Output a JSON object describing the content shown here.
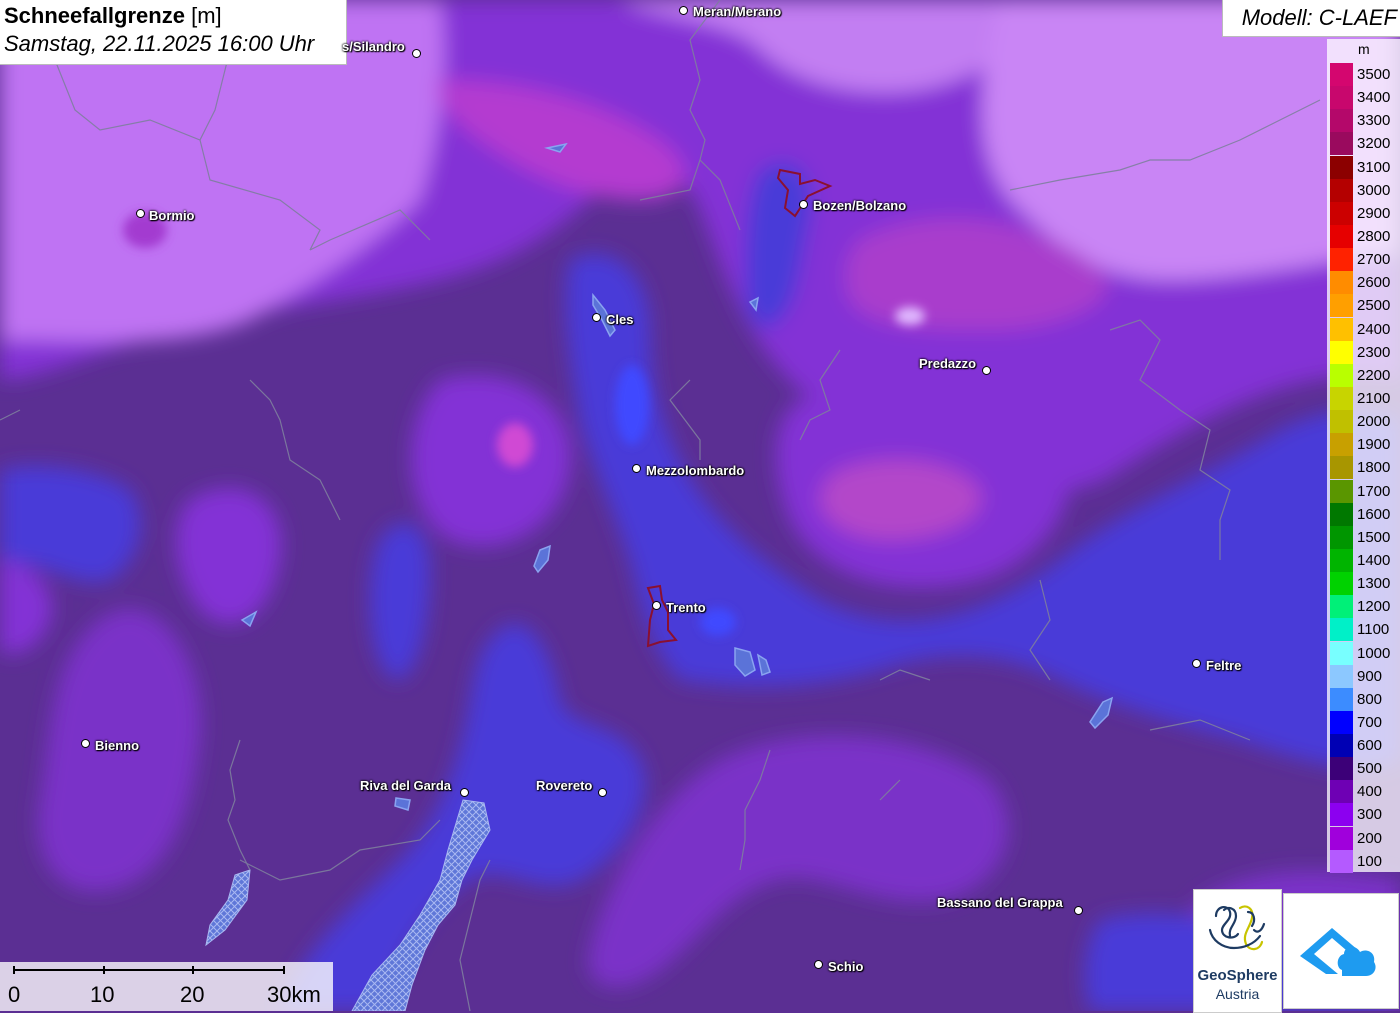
{
  "title": {
    "main": "Schneefallgrenze",
    "unit": "[m]",
    "datetime": "Samstag, 22.11.2025 16:00 Uhr"
  },
  "model": "Modell: C-LAEF",
  "legend": {
    "unit": "m",
    "entries": [
      {
        "label": "3500",
        "color": "#d4066f"
      },
      {
        "label": "3400",
        "color": "#c8076d"
      },
      {
        "label": "3300",
        "color": "#b4086a"
      },
      {
        "label": "3200",
        "color": "#9a0a5e"
      },
      {
        "label": "3100",
        "color": "#8c0000"
      },
      {
        "label": "3000",
        "color": "#b40000"
      },
      {
        "label": "2900",
        "color": "#cc0000"
      },
      {
        "label": "2800",
        "color": "#e60000"
      },
      {
        "label": "2700",
        "color": "#ff2200"
      },
      {
        "label": "2600",
        "color": "#ff8c00"
      },
      {
        "label": "2500",
        "color": "#ff9f00"
      },
      {
        "label": "2400",
        "color": "#ffc000"
      },
      {
        "label": "2300",
        "color": "#ffff00"
      },
      {
        "label": "2200",
        "color": "#b9ff00"
      },
      {
        "label": "2100",
        "color": "#c8d400"
      },
      {
        "label": "2000",
        "color": "#c0c000"
      },
      {
        "label": "1900",
        "color": "#c8a000"
      },
      {
        "label": "1800",
        "color": "#a89600"
      },
      {
        "label": "1700",
        "color": "#5a9600"
      },
      {
        "label": "1600",
        "color": "#007800"
      },
      {
        "label": "1500",
        "color": "#009600"
      },
      {
        "label": "1400",
        "color": "#00b400"
      },
      {
        "label": "1300",
        "color": "#00d200"
      },
      {
        "label": "1200",
        "color": "#00f078"
      },
      {
        "label": "1100",
        "color": "#00f0c8"
      },
      {
        "label": "1000",
        "color": "#78ffff"
      },
      {
        "label": "900",
        "color": "#8cc8ff"
      },
      {
        "label": "800",
        "color": "#3c8cff"
      },
      {
        "label": "700",
        "color": "#0000ff"
      },
      {
        "label": "600",
        "color": "#0000b4"
      },
      {
        "label": "500",
        "color": "#3c0078"
      },
      {
        "label": "400",
        "color": "#6e00b4"
      },
      {
        "label": "300",
        "color": "#8c00f0"
      },
      {
        "label": "200",
        "color": "#a000dc"
      },
      {
        "label": "100",
        "color": "#b45aff"
      }
    ]
  },
  "places": [
    {
      "name": "Meran/Merano"
    },
    {
      "name": "s/Silandro"
    },
    {
      "name": "Bormio"
    },
    {
      "name": "Bozen/Bolzano"
    },
    {
      "name": "Cles"
    },
    {
      "name": "Predazzo"
    },
    {
      "name": "Mezzolombardo"
    },
    {
      "name": "Trento"
    },
    {
      "name": "Feltre"
    },
    {
      "name": "Bienno"
    },
    {
      "name": "Riva del Garda"
    },
    {
      "name": "Rovereto"
    },
    {
      "name": "Bassano del Grappa"
    },
    {
      "name": "Schio"
    }
  ],
  "scale": {
    "labels": [
      "0",
      "10",
      "20",
      "30km"
    ]
  },
  "logos": {
    "geosphere_line1": "GeoSphere",
    "geosphere_line2": "Austria"
  }
}
